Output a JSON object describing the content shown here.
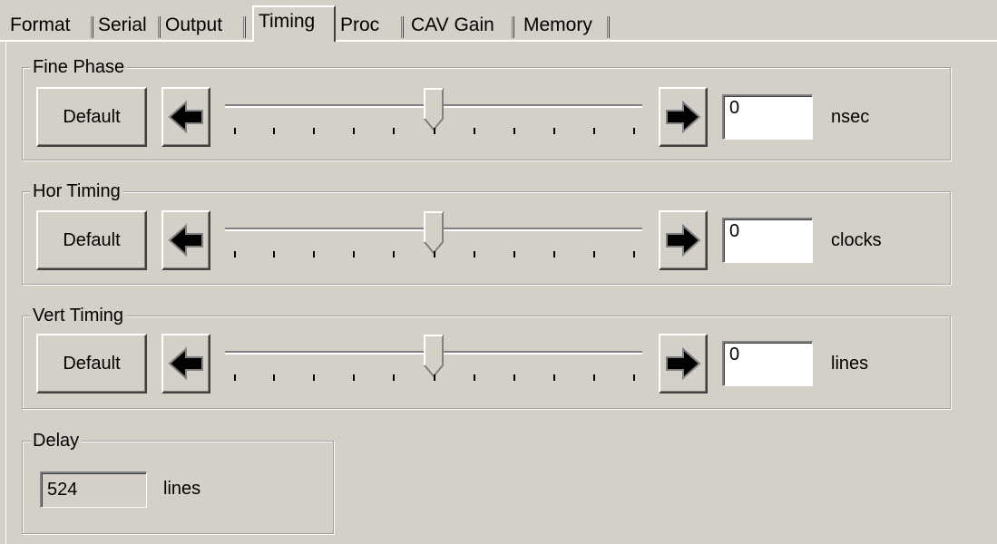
{
  "tabs": [
    "Format",
    "Serial",
    "Output",
    "Timing",
    "Proc",
    "CAV Gain",
    "Memory"
  ],
  "active_tab": "Timing",
  "groups": [
    {
      "title": "Fine Phase",
      "default_label": "Default",
      "value": "0",
      "unit": "nsec",
      "slider_position": 0.5
    },
    {
      "title": "Hor Timing",
      "default_label": "Default",
      "value": "0",
      "unit": "clocks",
      "slider_position": 0.5
    },
    {
      "title": "Vert Timing",
      "default_label": "Default",
      "value": "0",
      "unit": "lines",
      "slider_position": 0.5
    }
  ],
  "delay": {
    "title": "Delay",
    "value": "524",
    "unit": "lines"
  },
  "icons": {
    "decrement": "left-arrow-icon",
    "increment": "right-arrow-icon"
  }
}
